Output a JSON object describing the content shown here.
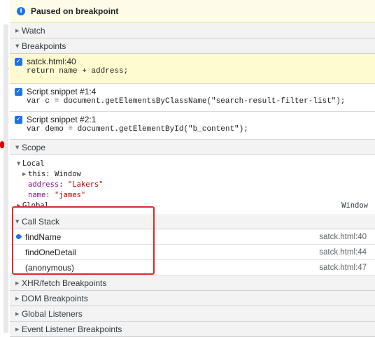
{
  "paused": {
    "icon": "info-icon",
    "text": "Paused on breakpoint"
  },
  "sections": {
    "watch": "Watch",
    "breakpoints": "Breakpoints",
    "scope": "Scope",
    "call_stack": "Call Stack",
    "xhr": "XHR/fetch Breakpoints",
    "dom": "DOM Breakpoints",
    "global_listeners": "Global Listeners",
    "event_listener": "Event Listener Breakpoints"
  },
  "breakpoints": [
    {
      "location": "satck.html:40",
      "code": "return name + address;",
      "checked": true,
      "active": true
    },
    {
      "location": "Script snippet #1:4",
      "code": "var c = document.getElementsByClassName(\"search-result-filter-list\");",
      "checked": true,
      "active": false
    },
    {
      "location": "Script snippet #2:1",
      "code": "var demo = document.getElementById(\"b_content\");",
      "checked": true,
      "active": false
    }
  ],
  "scope": {
    "local_label": "Local",
    "this_key": "this:",
    "this_value": "Window",
    "address_key": "address:",
    "address_value": "\"Lakers\"",
    "name_key": "name:",
    "name_value": "\"james\"",
    "global_label": "Global",
    "global_value": "Window"
  },
  "call_stack": [
    {
      "fn": "findName",
      "src": "satck.html:40",
      "current": true
    },
    {
      "fn": "findOneDetail",
      "src": "satck.html:44",
      "current": false
    },
    {
      "fn": "(anonymous)",
      "src": "satck.html:47",
      "current": false
    }
  ],
  "colors": {
    "accent": "#1a73e8",
    "paused_bg": "#fefce8",
    "highlight_border": "#d92c2c",
    "string": "#c80000",
    "key": "#881280"
  }
}
